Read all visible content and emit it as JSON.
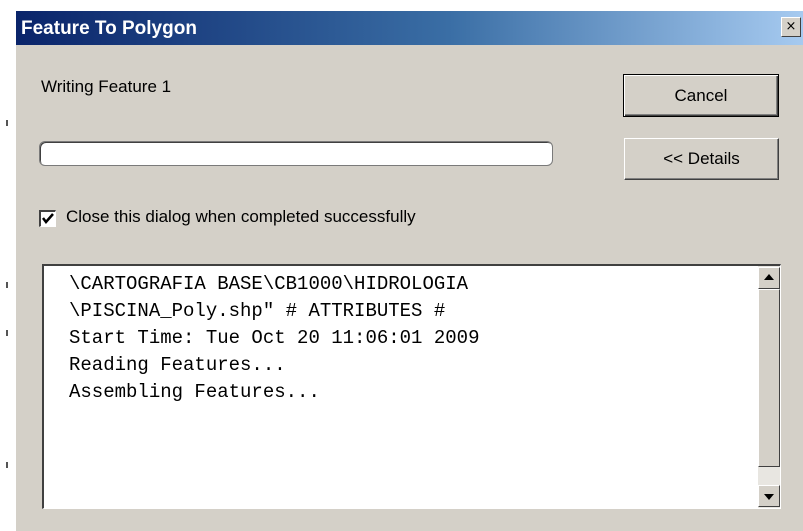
{
  "window": {
    "title": "Feature To Polygon",
    "close_glyph": "×"
  },
  "status": {
    "text": "Writing Feature 1"
  },
  "progress": {
    "fraction": 0.0
  },
  "buttons": {
    "cancel_label": "Cancel",
    "details_label": "<< Details"
  },
  "checkbox": {
    "label": "Close this dialog when completed successfully",
    "checked": true
  },
  "log": {
    "lines": [
      "\\CARTOGRAFIA BASE\\CB1000\\HIDROLOGIA",
      "\\PISCINA_Poly.shp\" # ATTRIBUTES #",
      "Start Time: Tue Oct 20 11:06:01 2009",
      "Reading Features...",
      "Assembling Features..."
    ]
  },
  "icons": {
    "close": "close-icon",
    "check": "checkmark-icon",
    "scroll_up": "arrow-up-icon",
    "scroll_down": "arrow-down-icon"
  },
  "colors": {
    "titlebar_start": "#0a246a",
    "titlebar_end": "#a6caf0",
    "dialog_face": "#d4d0c8"
  }
}
